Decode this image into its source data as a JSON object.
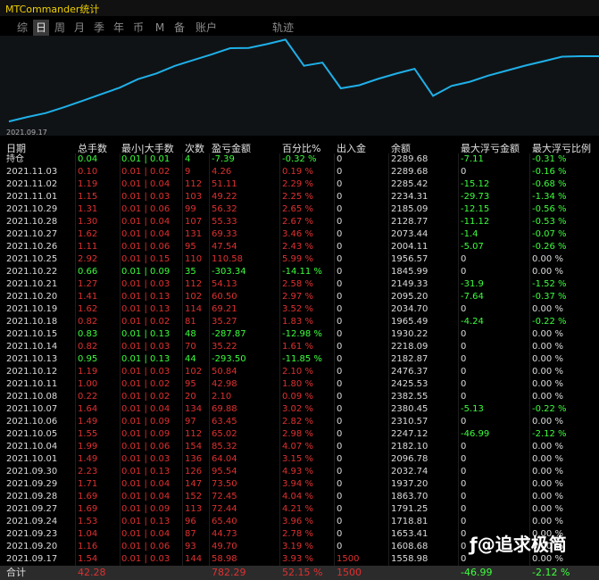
{
  "window": {
    "title": "MTCommander统计"
  },
  "tabs": [
    {
      "label": "综",
      "active": false
    },
    {
      "label": "日",
      "active": true
    },
    {
      "label": "周",
      "active": false
    },
    {
      "label": "月",
      "active": false
    },
    {
      "label": "季",
      "active": false
    },
    {
      "label": "年",
      "active": false
    },
    {
      "label": "币",
      "active": false
    },
    {
      "label": "M",
      "active": false
    },
    {
      "label": "备",
      "active": false
    },
    {
      "label": "账户",
      "active": false
    },
    {
      "label": "轨迹",
      "active": false
    }
  ],
  "chart": {
    "start_date": "2021.09.17",
    "line_color": "#1fb0e8"
  },
  "chart_data": {
    "type": "line",
    "x": [
      "2021.09.17",
      "2021.09.20",
      "2021.09.23",
      "2021.09.24",
      "2021.09.27",
      "2021.09.28",
      "2021.09.29",
      "2021.09.30",
      "2021.10.01",
      "2021.10.04",
      "2021.10.05",
      "2021.10.06",
      "2021.10.07",
      "2021.10.08",
      "2021.10.11",
      "2021.10.12",
      "2021.10.13",
      "2021.10.14",
      "2021.10.15",
      "2021.10.18",
      "2021.10.19",
      "2021.10.20",
      "2021.10.21",
      "2021.10.22",
      "2021.10.25",
      "2021.10.26",
      "2021.10.27",
      "2021.10.28",
      "2021.10.29",
      "2021.11.01",
      "2021.11.02",
      "2021.11.03",
      "持仓"
    ],
    "values": [
      1558.98,
      1608.68,
      1653.41,
      1718.81,
      1791.25,
      1863.7,
      1937.2,
      2032.74,
      2096.78,
      2182.1,
      2247.12,
      2310.57,
      2380.45,
      2382.55,
      2425.53,
      2476.37,
      2182.87,
      2218.09,
      1930.22,
      1965.49,
      2034.7,
      2095.2,
      2149.33,
      1845.99,
      1956.57,
      2004.11,
      2073.44,
      2128.77,
      2185.09,
      2234.31,
      2285.42,
      2289.68,
      2289.68
    ]
  },
  "columns": [
    "日期",
    "总手数",
    "最小|大手数",
    "次数",
    "盈亏金额",
    "百分比%",
    "出入金",
    "余额",
    "最大浮亏金额",
    "最大浮亏比例"
  ],
  "rows": [
    {
      "date": "持仓",
      "lots": "0.04",
      "minmax": "0.01 | 0.01",
      "count": "4",
      "pnl": "-7.39",
      "pct": "-0.32 %",
      "io": "0",
      "bal": "2289.68",
      "ddamt": "-7.11",
      "ddpct": "-0.31 %",
      "color": "green"
    },
    {
      "date": "2021.11.03",
      "lots": "0.10",
      "minmax": "0.01 | 0.02",
      "count": "9",
      "pnl": "4.26",
      "pct": "0.19 %",
      "io": "0",
      "bal": "2289.68",
      "ddamt": "0",
      "ddpct": "-0.16 %",
      "color": "red"
    },
    {
      "date": "2021.11.02",
      "lots": "1.19",
      "minmax": "0.01 | 0.04",
      "count": "112",
      "pnl": "51.11",
      "pct": "2.29 %",
      "io": "0",
      "bal": "2285.42",
      "ddamt": "-15.12",
      "ddpct": "-0.68 %",
      "color": "red"
    },
    {
      "date": "2021.11.01",
      "lots": "1.15",
      "minmax": "0.01 | 0.03",
      "count": "103",
      "pnl": "49.22",
      "pct": "2.25 %",
      "io": "0",
      "bal": "2234.31",
      "ddamt": "-29.73",
      "ddpct": "-1.34 %",
      "color": "red"
    },
    {
      "date": "2021.10.29",
      "lots": "1.31",
      "minmax": "0.01 | 0.06",
      "count": "99",
      "pnl": "56.32",
      "pct": "2.65 %",
      "io": "0",
      "bal": "2185.09",
      "ddamt": "-12.15",
      "ddpct": "-0.56 %",
      "color": "red"
    },
    {
      "date": "2021.10.28",
      "lots": "1.30",
      "minmax": "0.01 | 0.04",
      "count": "107",
      "pnl": "55.33",
      "pct": "2.67 %",
      "io": "0",
      "bal": "2128.77",
      "ddamt": "-11.12",
      "ddpct": "-0.53 %",
      "color": "red"
    },
    {
      "date": "2021.10.27",
      "lots": "1.62",
      "minmax": "0.01 | 0.04",
      "count": "131",
      "pnl": "69.33",
      "pct": "3.46 %",
      "io": "0",
      "bal": "2073.44",
      "ddamt": "-1.4",
      "ddpct": "-0.07 %",
      "color": "red"
    },
    {
      "date": "2021.10.26",
      "lots": "1.11",
      "minmax": "0.01 | 0.06",
      "count": "95",
      "pnl": "47.54",
      "pct": "2.43 %",
      "io": "0",
      "bal": "2004.11",
      "ddamt": "-5.07",
      "ddpct": "-0.26 %",
      "color": "red"
    },
    {
      "date": "2021.10.25",
      "lots": "2.92",
      "minmax": "0.01 | 0.15",
      "count": "110",
      "pnl": "110.58",
      "pct": "5.99 %",
      "io": "0",
      "bal": "1956.57",
      "ddamt": "0",
      "ddpct": "0.00 %",
      "color": "red"
    },
    {
      "date": "2021.10.22",
      "lots": "0.66",
      "minmax": "0.01 | 0.09",
      "count": "35",
      "pnl": "-303.34",
      "pct": "-14.11 %",
      "io": "0",
      "bal": "1845.99",
      "ddamt": "0",
      "ddpct": "0.00 %",
      "color": "green"
    },
    {
      "date": "2021.10.21",
      "lots": "1.27",
      "minmax": "0.01 | 0.03",
      "count": "112",
      "pnl": "54.13",
      "pct": "2.58 %",
      "io": "0",
      "bal": "2149.33",
      "ddamt": "-31.9",
      "ddpct": "-1.52 %",
      "color": "red"
    },
    {
      "date": "2021.10.20",
      "lots": "1.41",
      "minmax": "0.01 | 0.13",
      "count": "102",
      "pnl": "60.50",
      "pct": "2.97 %",
      "io": "0",
      "bal": "2095.20",
      "ddamt": "-7.64",
      "ddpct": "-0.37 %",
      "color": "red"
    },
    {
      "date": "2021.10.19",
      "lots": "1.62",
      "minmax": "0.01 | 0.13",
      "count": "114",
      "pnl": "69.21",
      "pct": "3.52 %",
      "io": "0",
      "bal": "2034.70",
      "ddamt": "0",
      "ddpct": "0.00 %",
      "color": "red"
    },
    {
      "date": "2021.10.18",
      "lots": "0.82",
      "minmax": "0.01 | 0.02",
      "count": "81",
      "pnl": "35.27",
      "pct": "1.83 %",
      "io": "0",
      "bal": "1965.49",
      "ddamt": "-4.24",
      "ddpct": "-0.22 %",
      "color": "red"
    },
    {
      "date": "2021.10.15",
      "lots": "0.83",
      "minmax": "0.01 | 0.13",
      "count": "48",
      "pnl": "-287.87",
      "pct": "-12.98 %",
      "io": "0",
      "bal": "1930.22",
      "ddamt": "0",
      "ddpct": "0.00 %",
      "color": "green"
    },
    {
      "date": "2021.10.14",
      "lots": "0.82",
      "minmax": "0.01 | 0.03",
      "count": "70",
      "pnl": "35.22",
      "pct": "1.61 %",
      "io": "0",
      "bal": "2218.09",
      "ddamt": "0",
      "ddpct": "0.00 %",
      "color": "red"
    },
    {
      "date": "2021.10.13",
      "lots": "0.95",
      "minmax": "0.01 | 0.13",
      "count": "44",
      "pnl": "-293.50",
      "pct": "-11.85 %",
      "io": "0",
      "bal": "2182.87",
      "ddamt": "0",
      "ddpct": "0.00 %",
      "color": "green"
    },
    {
      "date": "2021.10.12",
      "lots": "1.19",
      "minmax": "0.01 | 0.03",
      "count": "102",
      "pnl": "50.84",
      "pct": "2.10 %",
      "io": "0",
      "bal": "2476.37",
      "ddamt": "0",
      "ddpct": "0.00 %",
      "color": "red"
    },
    {
      "date": "2021.10.11",
      "lots": "1.00",
      "minmax": "0.01 | 0.02",
      "count": "95",
      "pnl": "42.98",
      "pct": "1.80 %",
      "io": "0",
      "bal": "2425.53",
      "ddamt": "0",
      "ddpct": "0.00 %",
      "color": "red"
    },
    {
      "date": "2021.10.08",
      "lots": "0.22",
      "minmax": "0.01 | 0.02",
      "count": "20",
      "pnl": "2.10",
      "pct": "0.09 %",
      "io": "0",
      "bal": "2382.55",
      "ddamt": "0",
      "ddpct": "0.00 %",
      "color": "red"
    },
    {
      "date": "2021.10.07",
      "lots": "1.64",
      "minmax": "0.01 | 0.04",
      "count": "134",
      "pnl": "69.88",
      "pct": "3.02 %",
      "io": "0",
      "bal": "2380.45",
      "ddamt": "-5.13",
      "ddpct": "-0.22 %",
      "color": "red"
    },
    {
      "date": "2021.10.06",
      "lots": "1.49",
      "minmax": "0.01 | 0.09",
      "count": "97",
      "pnl": "63.45",
      "pct": "2.82 %",
      "io": "0",
      "bal": "2310.57",
      "ddamt": "0",
      "ddpct": "0.00 %",
      "color": "red"
    },
    {
      "date": "2021.10.05",
      "lots": "1.55",
      "minmax": "0.01 | 0.09",
      "count": "112",
      "pnl": "65.02",
      "pct": "2.98 %",
      "io": "0",
      "bal": "2247.12",
      "ddamt": "-46.99",
      "ddpct": "-2.12 %",
      "color": "red"
    },
    {
      "date": "2021.10.04",
      "lots": "1.99",
      "minmax": "0.01 | 0.06",
      "count": "154",
      "pnl": "85.32",
      "pct": "4.07 %",
      "io": "0",
      "bal": "2182.10",
      "ddamt": "0",
      "ddpct": "0.00 %",
      "color": "red"
    },
    {
      "date": "2021.10.01",
      "lots": "1.49",
      "minmax": "0.01 | 0.03",
      "count": "136",
      "pnl": "64.04",
      "pct": "3.15 %",
      "io": "0",
      "bal": "2096.78",
      "ddamt": "0",
      "ddpct": "0.00 %",
      "color": "red"
    },
    {
      "date": "2021.09.30",
      "lots": "2.23",
      "minmax": "0.01 | 0.13",
      "count": "126",
      "pnl": "95.54",
      "pct": "4.93 %",
      "io": "0",
      "bal": "2032.74",
      "ddamt": "0",
      "ddpct": "0.00 %",
      "color": "red"
    },
    {
      "date": "2021.09.29",
      "lots": "1.71",
      "minmax": "0.01 | 0.04",
      "count": "147",
      "pnl": "73.50",
      "pct": "3.94 %",
      "io": "0",
      "bal": "1937.20",
      "ddamt": "0",
      "ddpct": "0.00 %",
      "color": "red"
    },
    {
      "date": "2021.09.28",
      "lots": "1.69",
      "minmax": "0.01 | 0.04",
      "count": "152",
      "pnl": "72.45",
      "pct": "4.04 %",
      "io": "0",
      "bal": "1863.70",
      "ddamt": "0",
      "ddpct": "0.00 %",
      "color": "red"
    },
    {
      "date": "2021.09.27",
      "lots": "1.69",
      "minmax": "0.01 | 0.09",
      "count": "113",
      "pnl": "72.44",
      "pct": "4.21 %",
      "io": "0",
      "bal": "1791.25",
      "ddamt": "0",
      "ddpct": "0.00 %",
      "color": "red"
    },
    {
      "date": "2021.09.24",
      "lots": "1.53",
      "minmax": "0.01 | 0.13",
      "count": "96",
      "pnl": "65.40",
      "pct": "3.96 %",
      "io": "0",
      "bal": "1718.81",
      "ddamt": "0",
      "ddpct": "0.00 %",
      "color": "red"
    },
    {
      "date": "2021.09.23",
      "lots": "1.04",
      "minmax": "0.01 | 0.04",
      "count": "87",
      "pnl": "44.73",
      "pct": "2.78 %",
      "io": "0",
      "bal": "1653.41",
      "ddamt": "0",
      "ddpct": "0.00 %",
      "color": "red"
    },
    {
      "date": "2021.09.20",
      "lots": "1.16",
      "minmax": "0.01 | 0.06",
      "count": "93",
      "pnl": "49.70",
      "pct": "3.19 %",
      "io": "0",
      "bal": "1608.68",
      "ddamt": "0",
      "ddpct": "0.00 %",
      "color": "red"
    },
    {
      "date": "2021.09.17",
      "lots": "1.54",
      "minmax": "0.01 | 0.03",
      "count": "144",
      "pnl": "58.98",
      "pct": "3.93 %",
      "io": "1500",
      "bal": "1558.98",
      "ddamt": "0",
      "ddpct": "0.00 %",
      "color": "red"
    }
  ],
  "total": {
    "date": "合计",
    "lots": "42.28",
    "pnl": "782.29",
    "pct": "52.15 %",
    "io": "1500",
    "ddamt": "-46.99",
    "ddpct": "-2.12 %"
  },
  "watermark": {
    "text": "@追求极简"
  }
}
